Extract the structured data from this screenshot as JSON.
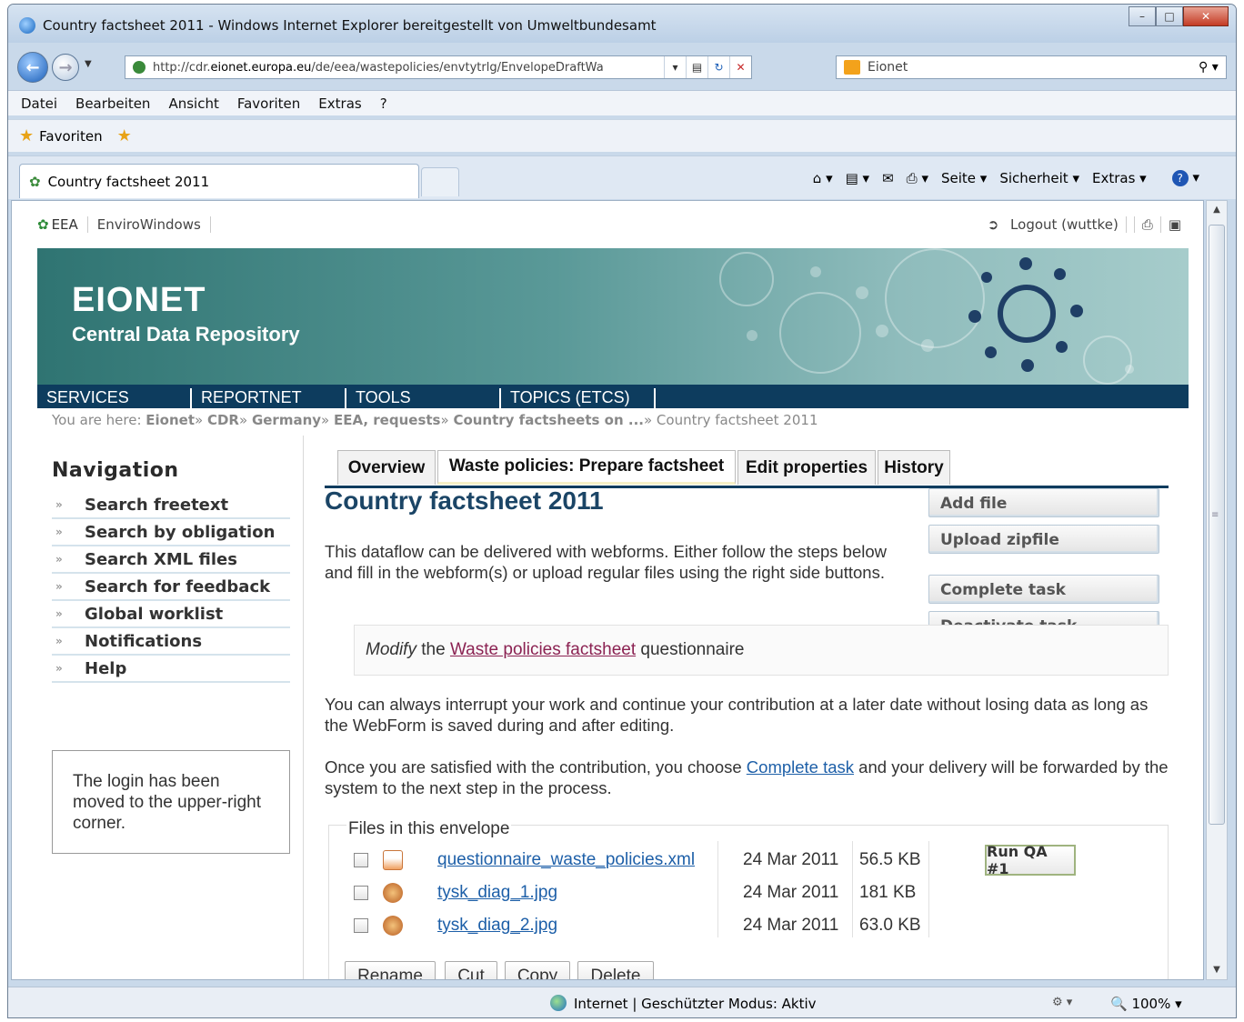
{
  "window": {
    "title": "Country factsheet 2011 - Windows Internet Explorer bereitgestellt von Umweltbundesamt",
    "minimize": "–",
    "maximize": "□",
    "close": "✕"
  },
  "address": {
    "url_prefix": "http://cdr.",
    "url_domain": "eionet.europa.eu",
    "url_rest": "/de/eea/wastepolicies/envtytrlg/EnvelopeDraftWa",
    "search_provider": "Eionet"
  },
  "menu": [
    "Datei",
    "Bearbeiten",
    "Ansicht",
    "Favoriten",
    "Extras",
    "?"
  ],
  "favorites_label": "Favoriten",
  "browser_tab": "Country factsheet 2011",
  "command_bar": [
    "Seite ▾",
    "Sicherheit ▾",
    "Extras ▾"
  ],
  "status": {
    "zone": "Internet | Geschützter Modus: Aktiv",
    "zoom": "100%"
  },
  "site": {
    "eea": "EEA",
    "envirowindows": "EnviroWindows",
    "logout": "Logout (wuttke)",
    "banner_title": "EIONET",
    "banner_subtitle": "Central Data Repository",
    "nav": [
      "SERVICES",
      "REPORTNET",
      "TOOLS",
      "TOPICS (ETCS)"
    ],
    "breadcrumb": {
      "prefix": "You are here:",
      "items": [
        "Eionet",
        "CDR",
        "Germany",
        "EEA, requests",
        "Country factsheets on ..."
      ],
      "current": "Country factsheet 2011"
    }
  },
  "sidebar": {
    "heading": "Navigation",
    "items": [
      "Search freetext",
      "Search by obligation",
      "Search XML files",
      "Search for feedback",
      "Global worklist",
      "Notifications",
      "Help"
    ],
    "login_note": "The login has been moved to the upper-right corner."
  },
  "tabs": [
    "Overview",
    "Waste policies: Prepare factsheet",
    "Edit properties",
    "History"
  ],
  "main": {
    "title": "Country factsheet 2011",
    "intro": "This dataflow can be delivered with webforms. Either follow the steps below and fill in the webform(s) or upload regular files using the right side buttons.",
    "modify_em": "Modify",
    "modify_the": " the ",
    "modify_link": "Waste policies factsheet",
    "modify_after": " questionnaire",
    "interrupt": "You can always interrupt your work and continue your contribution at a later date without losing data as long as the WebForm is saved during and after editing.",
    "complete_before": "Once you are satisfied with the contribution, you choose ",
    "complete_link": "Complete task",
    "complete_after": " and your delivery will be forwarded by the system to the next step in the process."
  },
  "side_buttons": [
    "Add file",
    "Upload zipfile",
    "Complete task",
    "Deactivate task"
  ],
  "files": {
    "legend": "Files in this envelope",
    "rows": [
      {
        "name": "questionnaire_waste_policies.xml",
        "date": "24 Mar 2011",
        "size": "56.5 KB",
        "icon": "xml-file-icon"
      },
      {
        "name": "tysk_diag_1.jpg",
        "date": "24 Mar 2011",
        "size": "181 KB",
        "icon": "image-file-icon"
      },
      {
        "name": "tysk_diag_2.jpg",
        "date": "24 Mar 2011",
        "size": "63.0 KB",
        "icon": "image-file-icon"
      }
    ],
    "qa_button": "Run QA #1",
    "actions": [
      "Rename",
      "Cut",
      "Copy",
      "Delete"
    ]
  }
}
